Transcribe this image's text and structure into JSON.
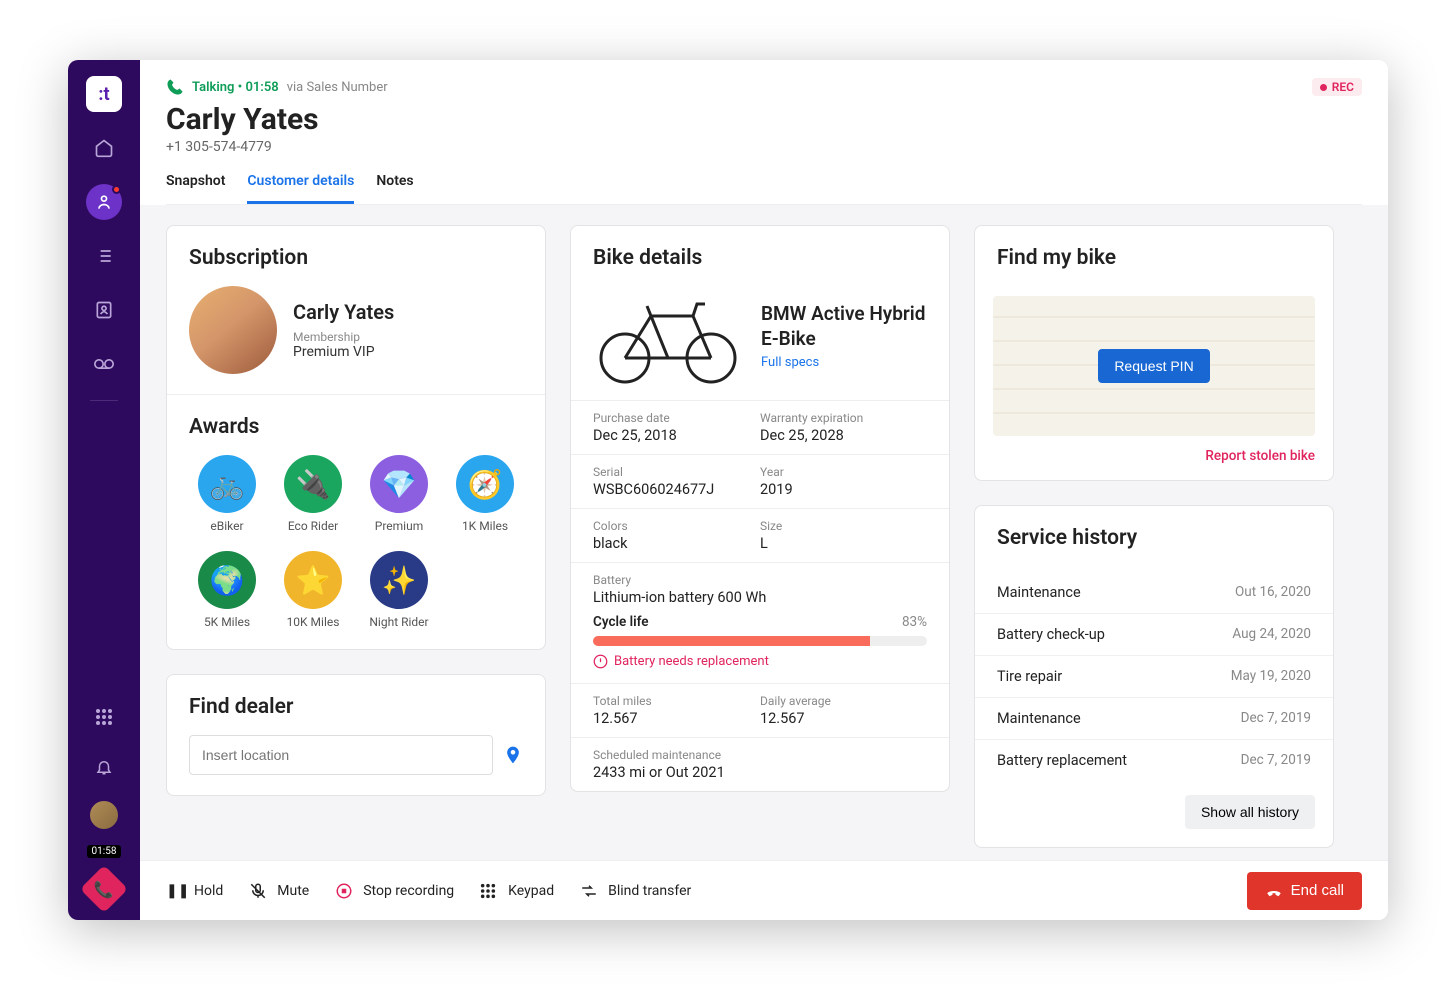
{
  "call": {
    "status": "Talking",
    "duration": "01:58",
    "via": "via Sales Number",
    "rec": "REC",
    "timer_badge": "01:58"
  },
  "customer": {
    "name": "Carly Yates",
    "phone": "+1 305-574-4779"
  },
  "tabs": {
    "snapshot": "Snapshot",
    "details": "Customer details",
    "notes": "Notes"
  },
  "subscription": {
    "title": "Subscription",
    "name": "Carly Yates",
    "membership_label": "Membership",
    "membership_value": "Premium VIP"
  },
  "awards": {
    "title": "Awards",
    "items": [
      {
        "label": "eBiker",
        "color": "#2aa6ef",
        "glyph": "🚲"
      },
      {
        "label": "Eco Rider",
        "color": "#1aa65f",
        "glyph": "🔌"
      },
      {
        "label": "Premium",
        "color": "#8c5fe0",
        "glyph": "💎"
      },
      {
        "label": "1K Miles",
        "color": "#2aa6ef",
        "glyph": "🧭"
      },
      {
        "label": "5K Miles",
        "color": "#1a8a48",
        "glyph": "🌍"
      },
      {
        "label": "10K Miles",
        "color": "#f1b52b",
        "glyph": "⭐"
      },
      {
        "label": "Night Rider",
        "color": "#293b87",
        "glyph": "✨"
      }
    ]
  },
  "dealer": {
    "title": "Find dealer",
    "placeholder": "Insert location"
  },
  "bike": {
    "title": "Bike details",
    "name": "BMW Active Hybrid E-Bike",
    "specs_link": "Full specs",
    "purchase": {
      "label": "Purchase date",
      "value": "Dec 25, 2018"
    },
    "warranty": {
      "label": "Warranty expiration",
      "value": "Dec 25, 2028"
    },
    "serial": {
      "label": "Serial",
      "value": "WSBC606024677J"
    },
    "year": {
      "label": "Year",
      "value": "2019"
    },
    "colors": {
      "label": "Colors",
      "value": "black"
    },
    "size": {
      "label": "Size",
      "value": "L"
    },
    "battery": {
      "label": "Battery",
      "value": "Lithium-ion battery 600 Wh"
    },
    "cycle": {
      "label": "Cycle life",
      "percent": "83%",
      "percent_num": 83
    },
    "warn": "Battery needs replacement",
    "miles": {
      "label": "Total miles",
      "value": "12.567"
    },
    "daily": {
      "label": "Daily average",
      "value": "12.567"
    },
    "maint": {
      "label": "Scheduled maintenance",
      "value": "2433 mi or Out 2021"
    }
  },
  "findbike": {
    "title": "Find my bike",
    "button": "Request PIN",
    "report": "Report stolen bike"
  },
  "history": {
    "title": "Service history",
    "items": [
      {
        "label": "Maintenance",
        "date": "Out 16, 2020"
      },
      {
        "label": "Battery check-up",
        "date": "Aug 24, 2020"
      },
      {
        "label": "Tire repair",
        "date": "May 19, 2020"
      },
      {
        "label": "Maintenance",
        "date": "Dec 7, 2019"
      },
      {
        "label": "Battery replacement",
        "date": "Dec 7, 2019"
      }
    ],
    "show_all": "Show all history"
  },
  "controls": {
    "hold": "Hold",
    "mute": "Mute",
    "stop_rec": "Stop recording",
    "keypad": "Keypad",
    "blind": "Blind transfer",
    "end": "End call"
  }
}
